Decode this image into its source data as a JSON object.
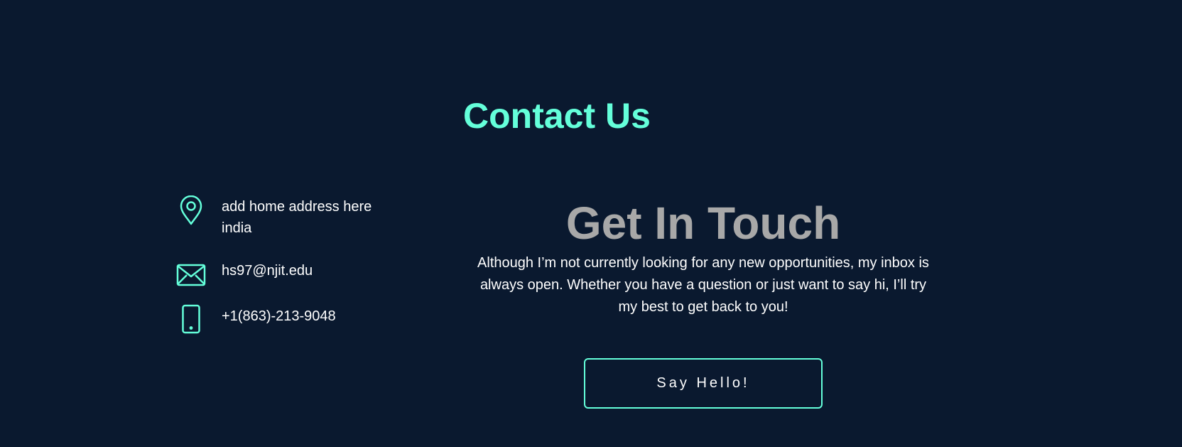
{
  "title": "Contact Us",
  "contact": {
    "address_line1": "add home address here",
    "address_line2": "india",
    "email": "hs97@njit.edu",
    "phone": "+1(863)-213-9048"
  },
  "touch": {
    "heading": "Get In Touch",
    "body": "Although I’m not currently looking for any new opportunities, my inbox is always open. Whether you have a question or just want to say hi, I’ll try my best to get back to you!",
    "button_label": "Say Hello!"
  },
  "icons": {
    "address": "map-pin-icon",
    "email": "envelope-icon",
    "phone": "phone-icon"
  },
  "colors": {
    "background": "#0a192f",
    "accent": "#64ffda",
    "heading_gray": "#a8a8a8",
    "text": "#ffffff"
  }
}
